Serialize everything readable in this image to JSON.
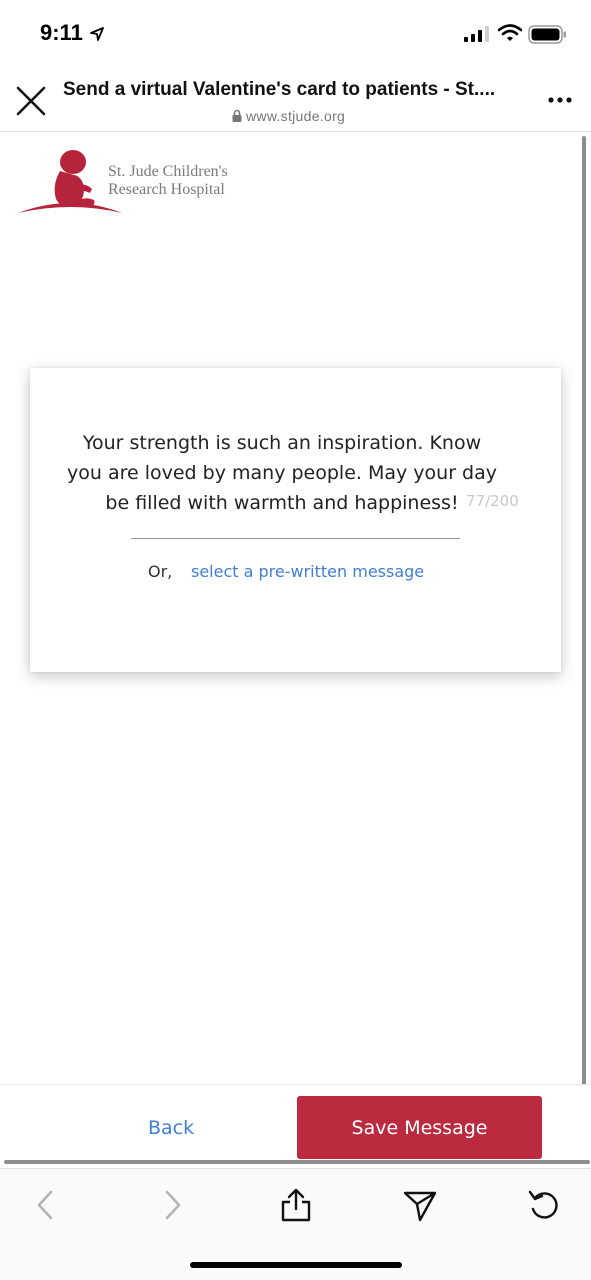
{
  "status_bar": {
    "time": "9:11",
    "icons": [
      "location-arrow-icon",
      "cellular-signal-icon",
      "wifi-icon",
      "battery-icon"
    ]
  },
  "browser": {
    "page_title": "Send a virtual Valentine's card to patients - St....",
    "url": "www.stjude.org",
    "close_icon": "close-icon",
    "more_icon": "more-dots-icon"
  },
  "logo": {
    "line1": "St. Jude Children's",
    "line2": "Research Hospital",
    "color": "#b5243a"
  },
  "message_card": {
    "message": "Your strength is such an inspiration. Know you are loved by many people. May your day be filled with warmth and happiness!",
    "char_count": "77/200",
    "or_label": "Or,",
    "prewritten_link": "select a pre-written message"
  },
  "actions": {
    "back_label": "Back",
    "save_label": "Save Message",
    "save_color": "#bb2a3e",
    "link_color": "#3f7fd6"
  },
  "toolbar": {
    "items": [
      "back-arrow-icon",
      "forward-arrow-icon",
      "share-icon",
      "send-icon",
      "reload-icon"
    ]
  }
}
